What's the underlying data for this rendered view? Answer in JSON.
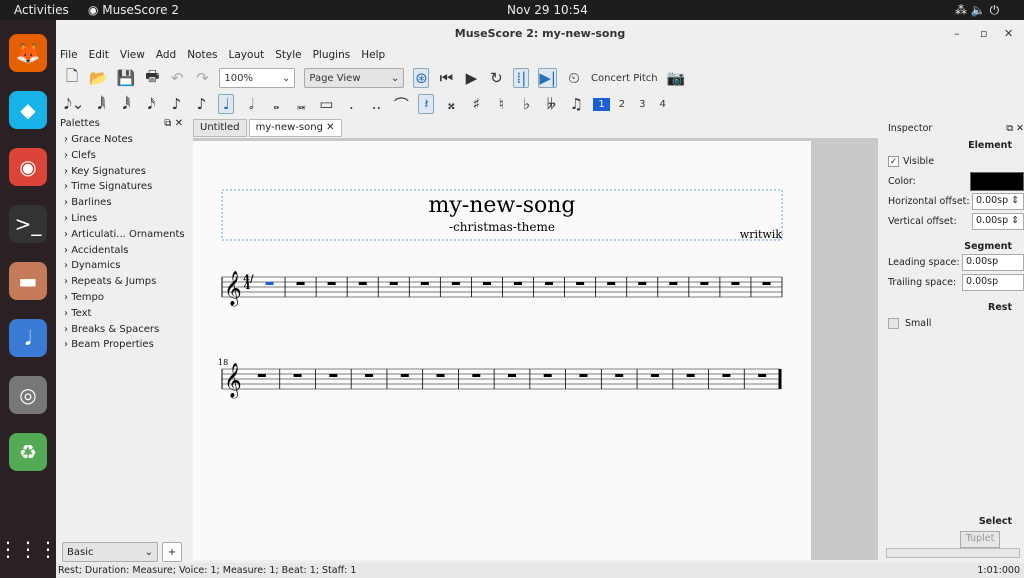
{
  "system": {
    "activities": "Activities",
    "app": "MuseScore 2",
    "clock": "Nov 29  10:54"
  },
  "dock": [
    {
      "name": "firefox-icon"
    },
    {
      "name": "kodi-icon"
    },
    {
      "name": "chrome-icon"
    },
    {
      "name": "terminal-icon"
    },
    {
      "name": "files-icon"
    },
    {
      "name": "musescore-icon"
    },
    {
      "name": "disc-icon"
    },
    {
      "name": "trash-icon"
    },
    {
      "name": "apps-grid-icon"
    }
  ],
  "window": {
    "title": "MuseScore 2: my-new-song"
  },
  "menu": [
    "File",
    "Edit",
    "View",
    "Add",
    "Notes",
    "Layout",
    "Style",
    "Plugins",
    "Help"
  ],
  "toolbar": {
    "zoom": "100%",
    "view_mode": "Page View",
    "concert_pitch": "Concert Pitch"
  },
  "note_toolbar": {
    "voices": [
      "1",
      "2",
      "3",
      "4"
    ],
    "active_voice": "1",
    "active_duration": "quarter"
  },
  "palettes": {
    "title": "Palettes",
    "items": [
      "Grace Notes",
      "Clefs",
      "Key Signatures",
      "Time Signatures",
      "Barlines",
      "Lines",
      "Articulati... Ornaments",
      "Accidentals",
      "Dynamics",
      "Repeats & Jumps",
      "Tempo",
      "Text",
      "Breaks & Spacers",
      "Beam Properties"
    ],
    "workspace": "Basic",
    "add": "+"
  },
  "tabs": [
    {
      "label": "Untitled"
    },
    {
      "label": "my-new-song",
      "active": true
    }
  ],
  "score": {
    "title": "my-new-song",
    "subtitle": "-christmas-theme",
    "composer": "writwik",
    "time_signature": "4/4",
    "system2_measure_number": "18",
    "system1_measures": 17,
    "system2_measures": 15,
    "selection_color": "#1a5fd6"
  },
  "inspector": {
    "title": "Inspector",
    "element": "Element",
    "visible": "Visible",
    "visible_checked": true,
    "color_label": "Color:",
    "color": "#000000",
    "h_offset_label": "Horizontal offset:",
    "h_offset": "0.00sp",
    "v_offset_label": "Vertical offset:",
    "v_offset": "0.00sp",
    "segment": "Segment",
    "leading_label": "Leading space:",
    "leading": "0.00sp",
    "trailing_label": "Trailing space:",
    "trailing": "0.00sp",
    "rest": "Rest",
    "small": "Small",
    "select": "Select",
    "tuplet": "Tuplet"
  },
  "status": {
    "text": "Rest; Duration: Measure; Voice: 1; Measure: 1; Beat: 1; Staff: 1",
    "time": "1:01:000"
  }
}
